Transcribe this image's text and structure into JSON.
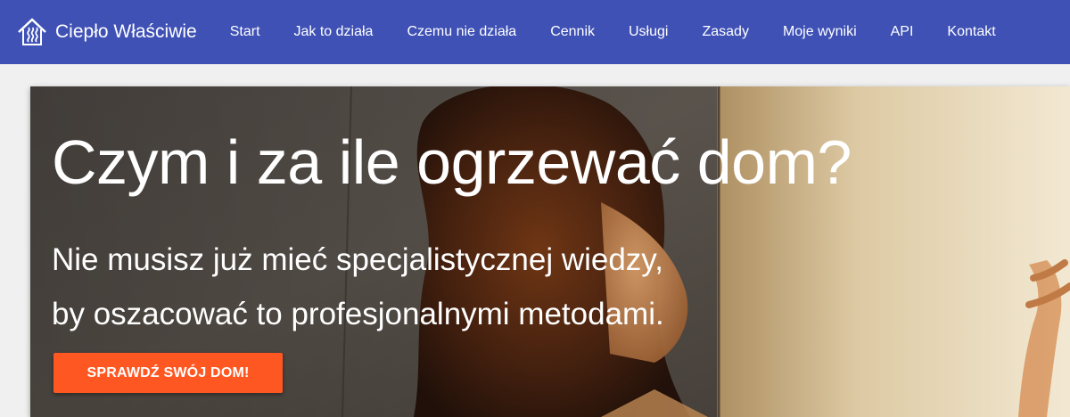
{
  "navbar": {
    "brand_logo_icon": "house-steam-icon",
    "brand_name": "Ciepło Właściwie",
    "items": [
      {
        "label": "Start"
      },
      {
        "label": "Jak to działa"
      },
      {
        "label": "Czemu nie działa"
      },
      {
        "label": "Cennik"
      },
      {
        "label": "Usługi"
      },
      {
        "label": "Zasady"
      },
      {
        "label": "Moje wyniki"
      },
      {
        "label": "API"
      },
      {
        "label": "Kontakt"
      }
    ]
  },
  "hero": {
    "title": "Czym i za ile ogrzewać dom?",
    "subtitle_line1": "Nie musisz już mieć specjalistycznej wiedzy,",
    "subtitle_line2": "by oszacować to profesjonalnymi metodami.",
    "cta_label": "SPRAWDŹ SWÓJ DOM!"
  },
  "colors": {
    "navbar_bg": "#3f51b5",
    "page_bg": "#f0f0f0",
    "cta_bg": "#ff5722",
    "text": "#ffffff"
  }
}
